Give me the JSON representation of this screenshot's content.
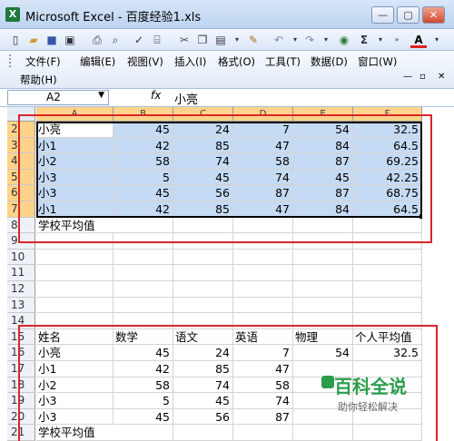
{
  "window": {
    "title": "Microsoft Excel - 百度经验1.xls",
    "app_icon": "X"
  },
  "toolbar": {
    "sigma": "Σ",
    "font_color": "A"
  },
  "menus": [
    "文件(F)",
    "编辑(E)",
    "视图(V)",
    "插入(I)",
    "格式(O)",
    "工具(T)",
    "数据(D)",
    "窗口(W)"
  ],
  "help_menu": "帮助(H)",
  "formula_bar": {
    "name_box": "A2",
    "fx": "fx",
    "value": "小亮"
  },
  "columns": [
    "A",
    "B",
    "C",
    "D",
    "E",
    "F"
  ],
  "rows": [
    {
      "n": "2",
      "cells": [
        "小亮",
        "45",
        "24",
        "7",
        "54",
        "32.5"
      ]
    },
    {
      "n": "3",
      "cells": [
        "小1",
        "42",
        "85",
        "47",
        "84",
        "64.5"
      ]
    },
    {
      "n": "4",
      "cells": [
        "小2",
        "58",
        "74",
        "58",
        "87",
        "69.25"
      ]
    },
    {
      "n": "5",
      "cells": [
        "小3",
        "5",
        "45",
        "74",
        "45",
        "42.25"
      ]
    },
    {
      "n": "6",
      "cells": [
        "小3",
        "45",
        "56",
        "87",
        "87",
        "68.75"
      ]
    },
    {
      "n": "7",
      "cells": [
        "小1",
        "42",
        "85",
        "47",
        "84",
        "64.5"
      ]
    },
    {
      "n": "8",
      "cells": [
        "学校平均值",
        "",
        "",
        "",
        "",
        ""
      ]
    },
    {
      "n": "9",
      "cells": [
        "",
        "",
        "",
        "",
        "",
        ""
      ]
    },
    {
      "n": "10",
      "cells": [
        "",
        "",
        "",
        "",
        "",
        ""
      ]
    },
    {
      "n": "11",
      "cells": [
        "",
        "",
        "",
        "",
        "",
        ""
      ]
    },
    {
      "n": "12",
      "cells": [
        "",
        "",
        "",
        "",
        "",
        ""
      ]
    },
    {
      "n": "13",
      "cells": [
        "",
        "",
        "",
        "",
        "",
        ""
      ]
    },
    {
      "n": "14",
      "cells": [
        "",
        "",
        "",
        "",
        "",
        ""
      ]
    },
    {
      "n": "15",
      "cells": [
        "姓名",
        "数学",
        "语文",
        "英语",
        "物理",
        "个人平均值"
      ]
    },
    {
      "n": "16",
      "cells": [
        "小亮",
        "45",
        "24",
        "7",
        "54",
        "32.5"
      ]
    },
    {
      "n": "17",
      "cells": [
        "小1",
        "42",
        "85",
        "47",
        "",
        ""
      ]
    },
    {
      "n": "18",
      "cells": [
        "小2",
        "58",
        "74",
        "58",
        "",
        ""
      ]
    },
    {
      "n": "19",
      "cells": [
        "小3",
        "5",
        "45",
        "74",
        "",
        ""
      ]
    },
    {
      "n": "20",
      "cells": [
        "小3",
        "45",
        "56",
        "87",
        "",
        ""
      ]
    },
    {
      "n": "21",
      "cells": [
        "学校平均值",
        "",
        "",
        "",
        "",
        ""
      ]
    }
  ],
  "watermark": {
    "title": "百科全说",
    "subtitle": "助你轻松解决"
  },
  "colors": {
    "selection": "#c5daf3",
    "header_selected": "#ffd38a",
    "highlight_border": "#d9252a"
  }
}
